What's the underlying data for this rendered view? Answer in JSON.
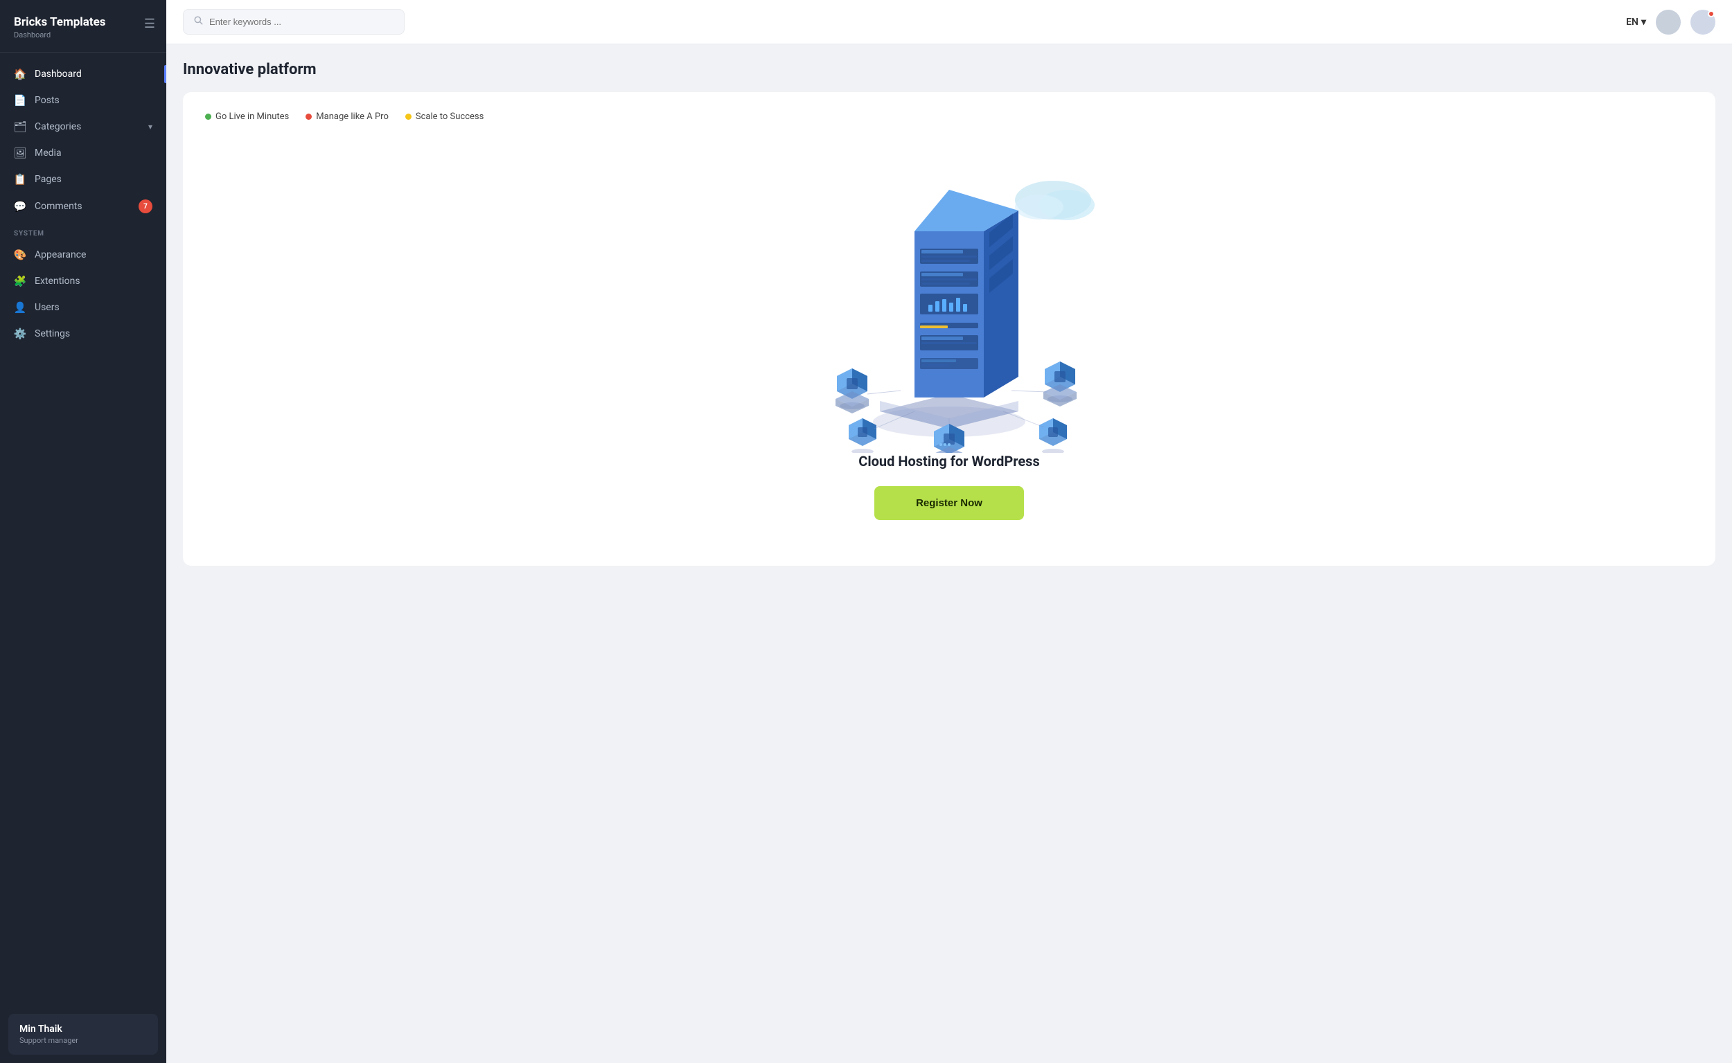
{
  "sidebar": {
    "title": "Bricks Templates",
    "subtitle": "Dashboard",
    "nav_items": [
      {
        "id": "dashboard",
        "label": "Dashboard",
        "icon": "🏠",
        "active": true
      },
      {
        "id": "posts",
        "label": "Posts",
        "icon": "📄"
      },
      {
        "id": "categories",
        "label": "Categories",
        "icon": "🗂",
        "chevron": true
      },
      {
        "id": "media",
        "label": "Media",
        "icon": "🖼"
      },
      {
        "id": "pages",
        "label": "Pages",
        "icon": "📋",
        "active_bar": true
      },
      {
        "id": "comments",
        "label": "Comments",
        "icon": "💬",
        "badge": "7"
      }
    ],
    "system_label": "SYSTEM",
    "system_items": [
      {
        "id": "appearance",
        "label": "Appearance",
        "icon": "🎨"
      },
      {
        "id": "extensions",
        "label": "Extentions",
        "icon": "🧩"
      },
      {
        "id": "users",
        "label": "Users",
        "icon": "👤"
      },
      {
        "id": "settings",
        "label": "Settings",
        "icon": "⚙️"
      }
    ],
    "user": {
      "name": "Min Thaik",
      "role": "Support manager"
    }
  },
  "topbar": {
    "search_placeholder": "Enter keywords ...",
    "lang": "EN",
    "lang_chevron": "▾"
  },
  "main": {
    "page_title": "Innovative platform",
    "tags": [
      {
        "label": "Go Live in Minutes",
        "dot_class": "tag-dot-green"
      },
      {
        "label": "Manage like A Pro",
        "dot_class": "tag-dot-red"
      },
      {
        "label": "Scale to Success",
        "dot_class": "tag-dot-yellow"
      }
    ],
    "cloud_title": "Cloud Hosting for WordPress",
    "register_label": "Register Now"
  }
}
